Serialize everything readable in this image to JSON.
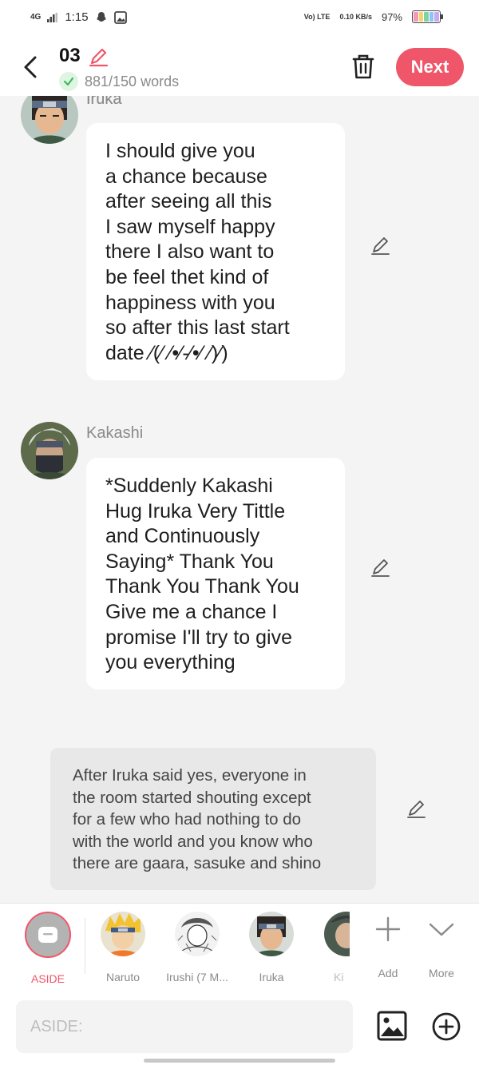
{
  "status_bar": {
    "network": "4G",
    "time": "1:15",
    "volte": "Vo) LTE",
    "speed": "0.10 KB/s",
    "battery": "97%"
  },
  "header": {
    "chapter": "03",
    "word_count": "881/150 words",
    "next_label": "Next"
  },
  "messages": [
    {
      "sender": "Iruka",
      "lines": [
        "I should give you",
        "a chance because",
        "after seeing all this",
        "I saw myself happy",
        "there I also want to",
        "be feel thet kind of",
        "happiness with you",
        "so after this last start",
        "date ⁄(⁄ ⁄•⁄-⁄•⁄ ⁄)⁄)"
      ]
    },
    {
      "sender": "Kakashi",
      "lines": [
        "*Suddenly Kakashi",
        "Hug Iruka Very Tittle",
        "and Continuously",
        "Saying* Thank You",
        "Thank You Thank You",
        "Give me a chance I",
        "promise I'll try to give",
        "you everything"
      ]
    }
  ],
  "aside": {
    "lines": [
      "After Iruka said yes, everyone in",
      "the room started shouting except",
      "for a few who had nothing to do",
      "with the world and you know who",
      "there are gaara, sasuke and shino"
    ]
  },
  "characters": [
    {
      "label": "ASIDE"
    },
    {
      "label": "Naruto"
    },
    {
      "label": "Irushi (7 M..."
    },
    {
      "label": "Iruka"
    },
    {
      "label": "Ki"
    },
    {
      "label": "Add"
    },
    {
      "label": "More"
    }
  ],
  "input": {
    "placeholder": "ASIDE:"
  },
  "colors": {
    "accent": "#f0566a",
    "background": "#f4f4f4",
    "bubble": "#ffffff",
    "aside_bubble": "#e8e8e8"
  }
}
